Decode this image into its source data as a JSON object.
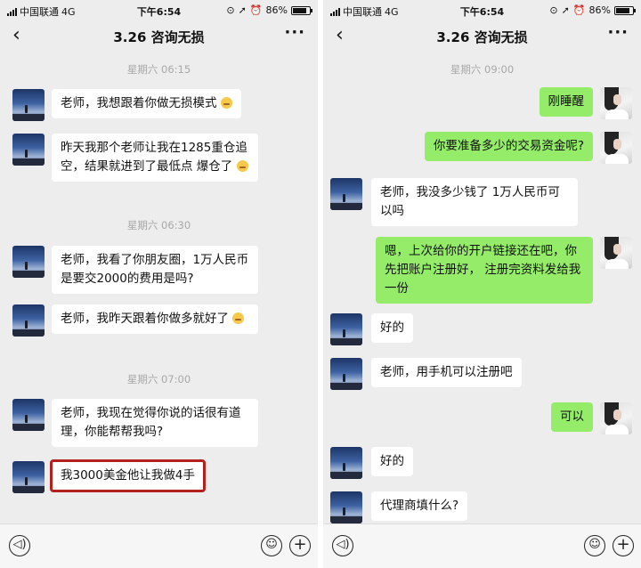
{
  "statusbar": {
    "carrier": "中国联通",
    "network": "4G",
    "time": "下午6:54",
    "battery": "86%",
    "battery_level": 0.86
  },
  "left": {
    "title": "3.26 咨询无损",
    "timestamps": [
      "星期六 06:15",
      "星期六 06:30",
      "星期六 07:00"
    ],
    "messages": [
      {
        "text": "老师，我想跟着你做无损模式"
      },
      {
        "text": "昨天我那个老师让我在1285重仓追空，结果就进到了最低点 爆仓了"
      },
      {
        "text": "老师，我看了你朋友圈，1万人民币是要交2000的费用是吗?"
      },
      {
        "text": "老师，我昨天跟着你做多就好了"
      },
      {
        "text": "老师，我现在觉得你说的话很有道理，你能帮帮我吗?"
      },
      {
        "text": "我3000美金他让我做4手"
      }
    ]
  },
  "right": {
    "title": "3.26 咨询无损",
    "timestamps": [
      "星期六 09:00"
    ],
    "messages": [
      {
        "text": "刚睡醒",
        "side": "out"
      },
      {
        "text": "你要准备多少的交易资金呢?",
        "side": "out"
      },
      {
        "text": "老师，我没多少钱了 1万人民币可以吗",
        "side": "in"
      },
      {
        "text": "嗯，上次给你的开户链接还在吧，你先把账户注册好， 注册完资料发给我一份",
        "side": "out"
      },
      {
        "text": "好的",
        "side": "in"
      },
      {
        "text": "老师，用手机可以注册吧",
        "side": "in"
      },
      {
        "text": "可以",
        "side": "out"
      },
      {
        "text": "好的",
        "side": "in"
      },
      {
        "text": "代理商填什么?",
        "side": "in"
      }
    ]
  },
  "icons": {
    "back": "back-chevron-icon",
    "more": "more-icon",
    "voice": "voice-icon",
    "emoji": "emoji-icon",
    "plus": "plus-icon"
  },
  "colors": {
    "incoming_bubble": "#ffffff",
    "outgoing_bubble": "#95ec69",
    "highlight_box": "#b3211f",
    "chat_background": "#ededed"
  }
}
